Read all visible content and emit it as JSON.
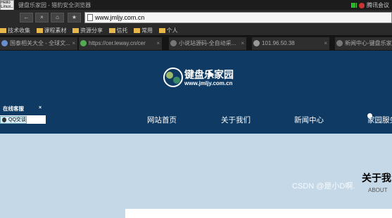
{
  "window": {
    "title": "键盘乐家园 - 猎豹安全浏览器",
    "network_label": "腾讯会议",
    "avatar_text": "Hello Linux..."
  },
  "toolbar": {
    "back": "←",
    "forward": "×",
    "home": "⌂",
    "star": "★",
    "url": "www.jmljy.com.cn"
  },
  "bookmarks": [
    "技术收集",
    "课程素材",
    "资源分享",
    "信托",
    "常用",
    "个人"
  ],
  "tabs": [
    {
      "label": "国泰相关大全 - 全球文..."
    },
    {
      "label": "https://cer.leway.cn/cer"
    },
    {
      "label": "小说站源码-全自动采..."
    },
    {
      "label": "101.96.50.38"
    },
    {
      "label": "新闻中心-键盘乐家园"
    }
  ],
  "site": {
    "brand": "键盘乐家园",
    "brand_url": "www.jmljy.com.cn",
    "menu": [
      "网站首页",
      "关于我们",
      "新闻中心",
      "家园服务"
    ],
    "service": {
      "header": "在线客服",
      "close": "×",
      "qq_label": "QQ交谈"
    },
    "about_title": "关于我",
    "about_sub": "ABOUT"
  },
  "watermark": "CSDN @是小D啊.",
  "colors": {
    "site_bg": "#0e3a63",
    "content_bg": "#c5d8e8"
  }
}
